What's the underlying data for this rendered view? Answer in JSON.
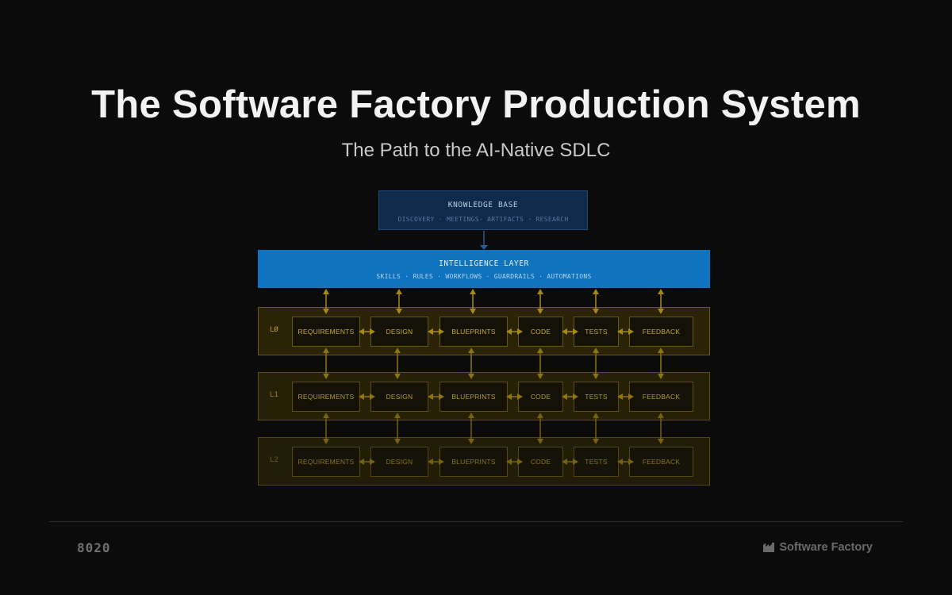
{
  "title": "The Software Factory Production System",
  "subtitle": "The Path to the AI-Native SDLC",
  "knowledge_base": {
    "title": "KNOWLEDGE BASE",
    "subtitle": "DISCOVERY · MEETINGS· ARTIFACTS · RESEARCH"
  },
  "intelligence_layer": {
    "title": "INTELLIGENCE LAYER",
    "subtitle": "SKILLS · RULES · WORKFLOWS · GUARDRAILS · AUTOMATIONS"
  },
  "layers": [
    {
      "label": "LØ",
      "stages": [
        "REQUIREMENTS",
        "DESIGN",
        "BLUEPRINTS",
        "CODE",
        "TESTS",
        "FEEDBACK"
      ]
    },
    {
      "label": "L1",
      "stages": [
        "REQUIREMENTS",
        "DESIGN",
        "BLUEPRINTS",
        "CODE",
        "TESTS",
        "FEEDBACK"
      ]
    },
    {
      "label": "L2",
      "stages": [
        "REQUIREMENTS",
        "DESIGN",
        "BLUEPRINTS",
        "CODE",
        "TESTS",
        "FEEDBACK"
      ]
    }
  ],
  "footer": {
    "left_logo": "8020",
    "right_logo": "Software Factory",
    "right_logo_icon": "factory-icon"
  },
  "colors": {
    "background": "#0b0b0b",
    "knowledge_base": "#0f2a4a",
    "intelligence_layer": "#0f73bf",
    "layer_accent": "#c9ab2e"
  }
}
